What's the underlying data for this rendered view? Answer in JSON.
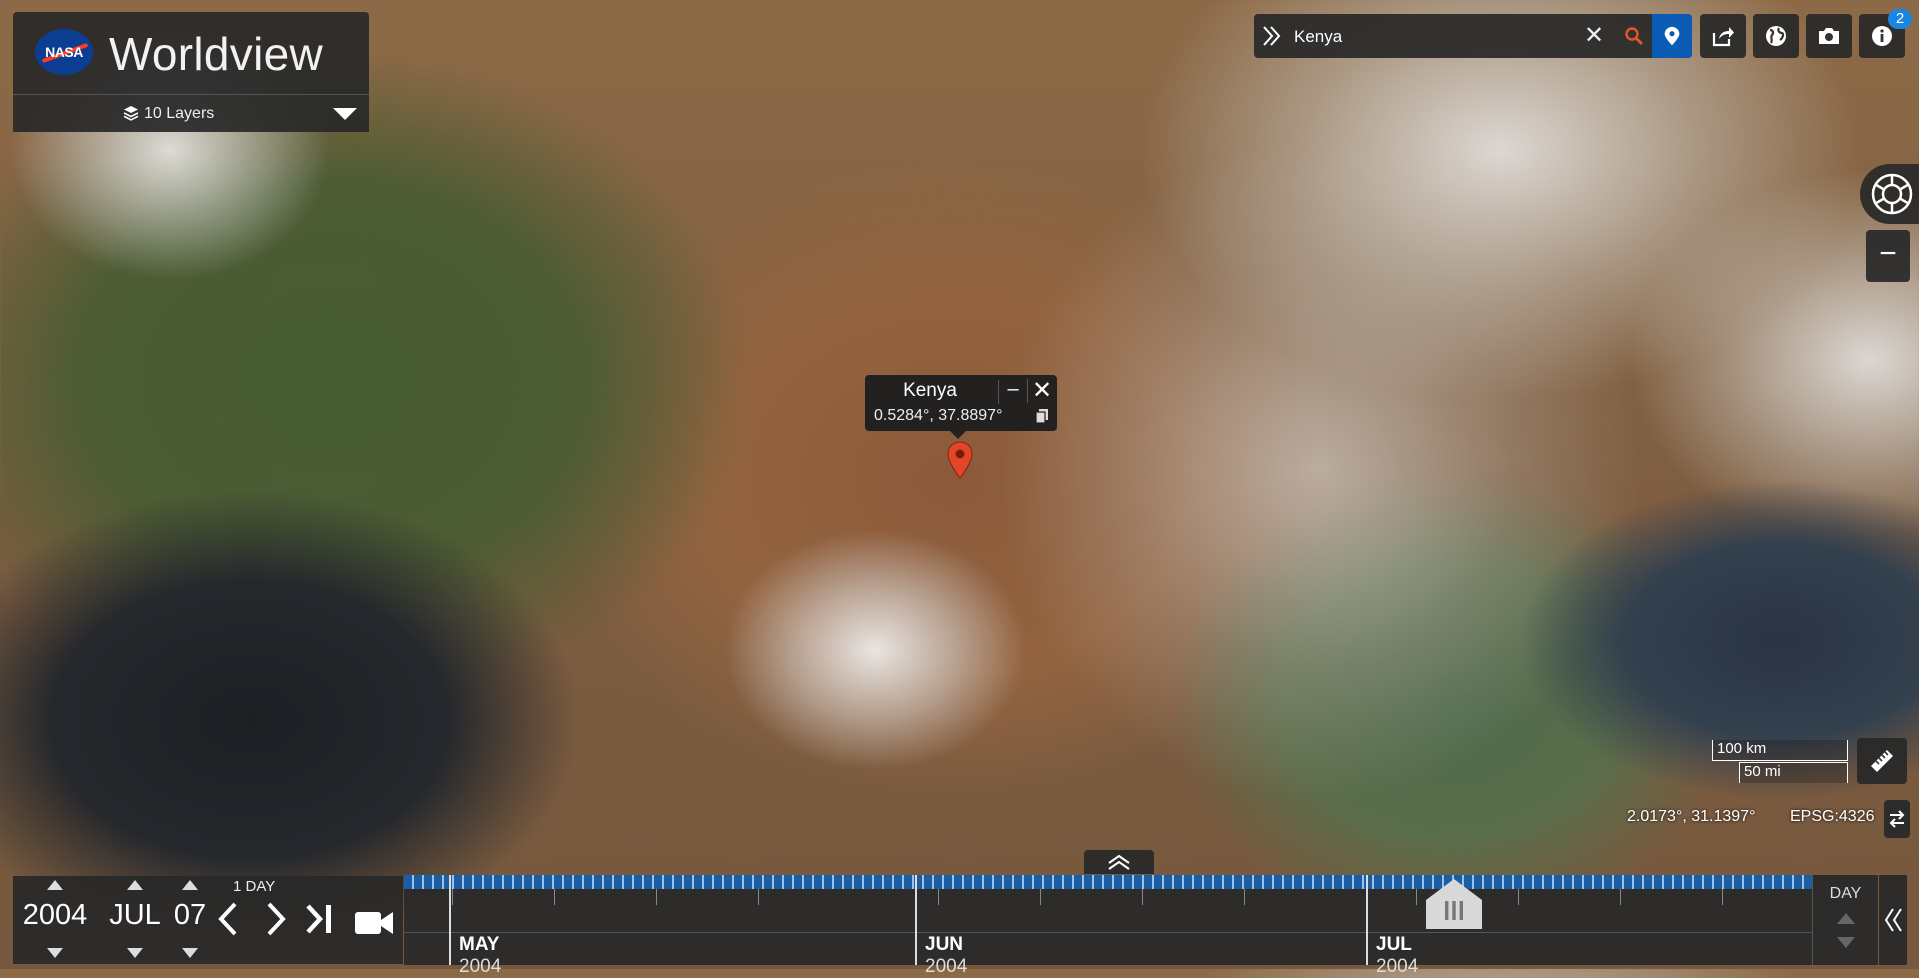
{
  "app": {
    "agency_logo_text": "NASA",
    "title": "Worldview"
  },
  "layers": {
    "label": "10 Layers"
  },
  "search": {
    "value": "Kenya",
    "clear_label": "✕"
  },
  "info": {
    "badge_count": "2"
  },
  "popup": {
    "title": "Kenya",
    "coords": "0.5284°, 37.8897°",
    "minimize_label": "–",
    "close_label": "✕"
  },
  "scale": {
    "km_label": "100 km",
    "mi_label": "50 mi"
  },
  "map": {
    "cursor_coords": "2.0173°, 31.1397°",
    "projection": "EPSG:4326"
  },
  "date": {
    "year": "2004",
    "month": "JUL",
    "day": "07",
    "interval": "1  DAY"
  },
  "timeline": {
    "months": [
      {
        "name": "MAY",
        "year": "2004"
      },
      {
        "name": "JUN",
        "year": "2004"
      },
      {
        "name": "JUL",
        "year": "2004"
      }
    ],
    "zoom_level": "DAY"
  },
  "colors": {
    "accent": "#0b5bb5",
    "marker": "#e2462a",
    "timeline_blue": "#1a5fa6",
    "badge": "#1b86e0"
  }
}
